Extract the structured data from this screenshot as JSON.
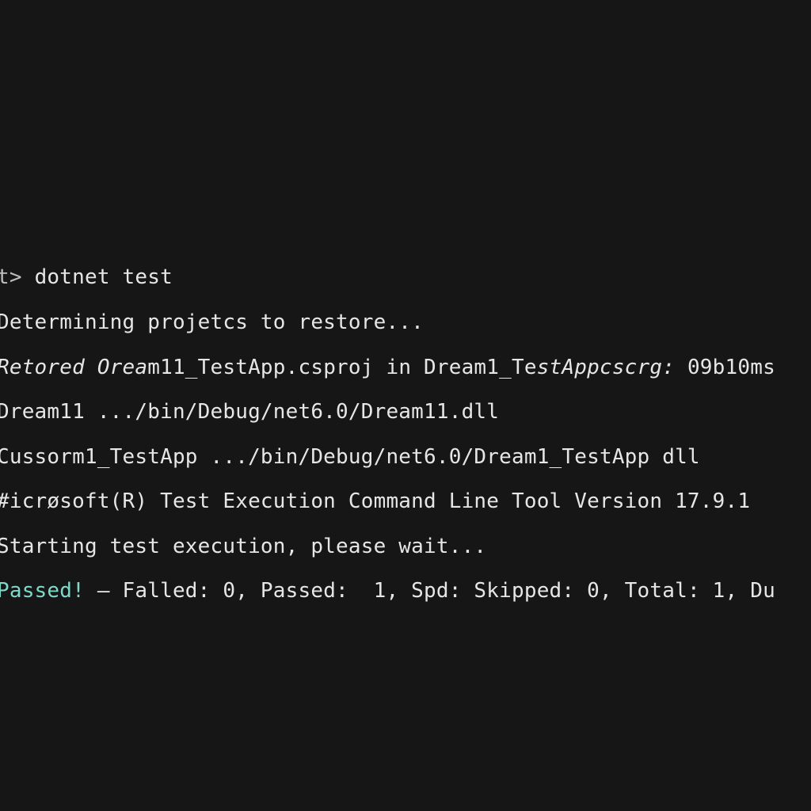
{
  "colors": {
    "background": "#161616",
    "text": "#e6e6e6",
    "passed": "#7fd9c8"
  },
  "terminal": {
    "prompt": "t> ",
    "command": "dotnet test",
    "lines": {
      "determining": "Determining projetcs to restore...",
      "restored_a": "Retored ",
      "restored_b": "Orea",
      "restored_c": "m11_TestApp.csproj in Dream1_Te",
      "restored_d": "stAppcscrg:",
      "restored_e": " 09b10ms",
      "dream11_dll": "Dream11 .../bin/Debug/net6.0/Dream11.dll",
      "test_app_dll": "Cussorm1_TestApp .../bin/Debug/net6.0/Dream1_TestApp dll",
      "ms_tool": "#icrøsoft(R) Test Execution Command Line Tool Version 17.9.1",
      "starting": "Starting test execution, please wait...",
      "passed_label": "Passed!",
      "summary": " — Falled: 0, Passed:  1, Spd: Skipped: 0, Total: 1, Du"
    }
  }
}
